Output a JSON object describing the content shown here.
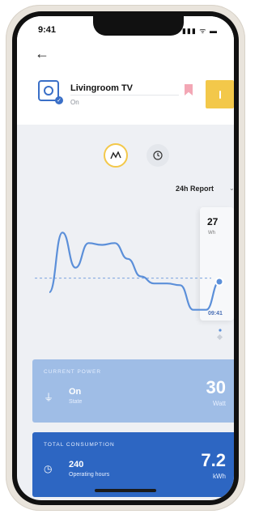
{
  "status_bar": {
    "time": "9:41",
    "icons": "▮▮▮ ᯤ ▬"
  },
  "header": {
    "back_icon": "←",
    "device_name": "Livingroom TV",
    "device_state": "On"
  },
  "chart_controls": {
    "graph_icon": "ʌʌ",
    "history_icon": "🕘",
    "report_label": "24h Report",
    "report_chevron": "⌄"
  },
  "chart_data": {
    "type": "line",
    "series": [
      {
        "values": [
          18,
          52,
          32,
          46,
          45,
          46,
          37,
          27,
          23,
          23,
          22,
          8,
          8,
          24
        ]
      }
    ],
    "ylim": [
      0,
      60
    ],
    "tooltip": {
      "value": "27",
      "unit": "Wh",
      "time": "09:41"
    }
  },
  "current_power": {
    "label": "CURRENT POWER",
    "state_value": "On",
    "state_label": "State",
    "value": "30",
    "unit": "Watt"
  },
  "total_consumption": {
    "label": "TOTAL CONSUMPTION",
    "hours_value": "240",
    "hours_label": "Operating hours",
    "value": "7.2",
    "unit": "kWh"
  },
  "colors": {
    "accent_yellow": "#f3c84a",
    "primary_blue": "#2d66c2",
    "light_blue": "#9fbde6",
    "line_blue": "#5b8fd9"
  }
}
